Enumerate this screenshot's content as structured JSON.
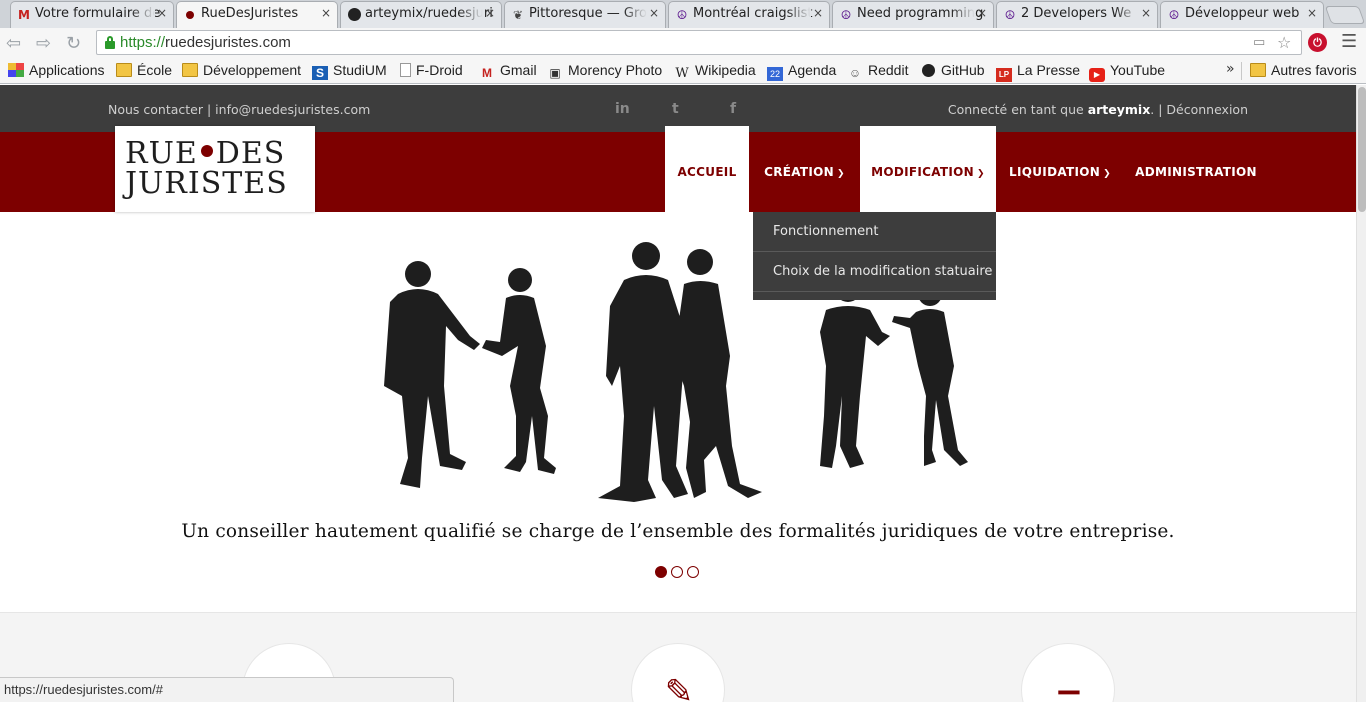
{
  "browser": {
    "tabs": [
      {
        "title": "Votre formulaire de",
        "icon": "gmail-icon",
        "active": false
      },
      {
        "title": "RueDesJuristes",
        "icon": "site-dot-icon",
        "active": true
      },
      {
        "title": "arteymix/ruedesjuri",
        "icon": "github-icon",
        "active": false
      },
      {
        "title": "Pittoresque — Gro",
        "icon": "leaf-icon",
        "active": false
      },
      {
        "title": "Montréal craigslist",
        "icon": "peace-icon",
        "active": false
      },
      {
        "title": "Need programming",
        "icon": "peace-icon",
        "active": false
      },
      {
        "title": "2 Developers We",
        "icon": "peace-icon",
        "active": false
      },
      {
        "title": "Développeur web",
        "icon": "peace-icon",
        "active": false
      }
    ],
    "close_glyph": "×",
    "url_scheme": "https://",
    "url_host": "ruedesjuristes.com",
    "bookmarks": [
      {
        "label": "Applications",
        "icon": "apps-grid-icon"
      },
      {
        "label": "École",
        "icon": "folder-icon"
      },
      {
        "label": "Développement",
        "icon": "folder-icon"
      },
      {
        "label": "StudiUM",
        "icon": "studium-icon"
      },
      {
        "label": "F-Droid",
        "icon": "page-icon"
      },
      {
        "label": "Gmail",
        "icon": "gmail-icon"
      },
      {
        "label": "Morency Photo",
        "icon": "camera-icon"
      },
      {
        "label": "Wikipedia",
        "icon": "wikipedia-icon"
      },
      {
        "label": "Agenda",
        "icon": "calendar-icon"
      },
      {
        "label": "Reddit",
        "icon": "reddit-icon"
      },
      {
        "label": "GitHub",
        "icon": "github-icon"
      },
      {
        "label": "La Presse",
        "icon": "lapresse-icon"
      },
      {
        "label": "YouTube",
        "icon": "youtube-icon"
      }
    ],
    "bookmarks_overflow": "»",
    "other_bookmarks": "Autres favoris",
    "status_url": "https://ruedesjuristes.com/#"
  },
  "site": {
    "contact_text": "Nous contacter | info@ruedesjuristes.com",
    "social": {
      "linkedin": "in",
      "twitter": "t",
      "facebook": "f"
    },
    "connected_prefix": "Connecté en tant que ",
    "username": "arteymix",
    "connected_suffix": ". | Déconnexion",
    "logo_line1_a": "RUE",
    "logo_line1_b": "DES",
    "logo_line2": "JURISTES",
    "nav": {
      "accueil": "ACCUEIL",
      "creation": "CRÉATION",
      "modification": "MODIFICATION",
      "liquidation": "LIQUIDATION",
      "administration": "ADMINISTRATION"
    },
    "dropdown": [
      "Fonctionnement",
      "Choix de la modification statuaire"
    ],
    "hero_caption": "Un conseiller hautement qualifié se charge de l’ensemble des formalités juridiques de votre entreprise.",
    "slider": {
      "count": 3,
      "active": 1
    },
    "feature_glyphs": {
      "add": "+",
      "edit": "✎",
      "remove": "−"
    }
  },
  "colors": {
    "brand_red": "#7d0000",
    "topbar": "#3d3d3d"
  }
}
